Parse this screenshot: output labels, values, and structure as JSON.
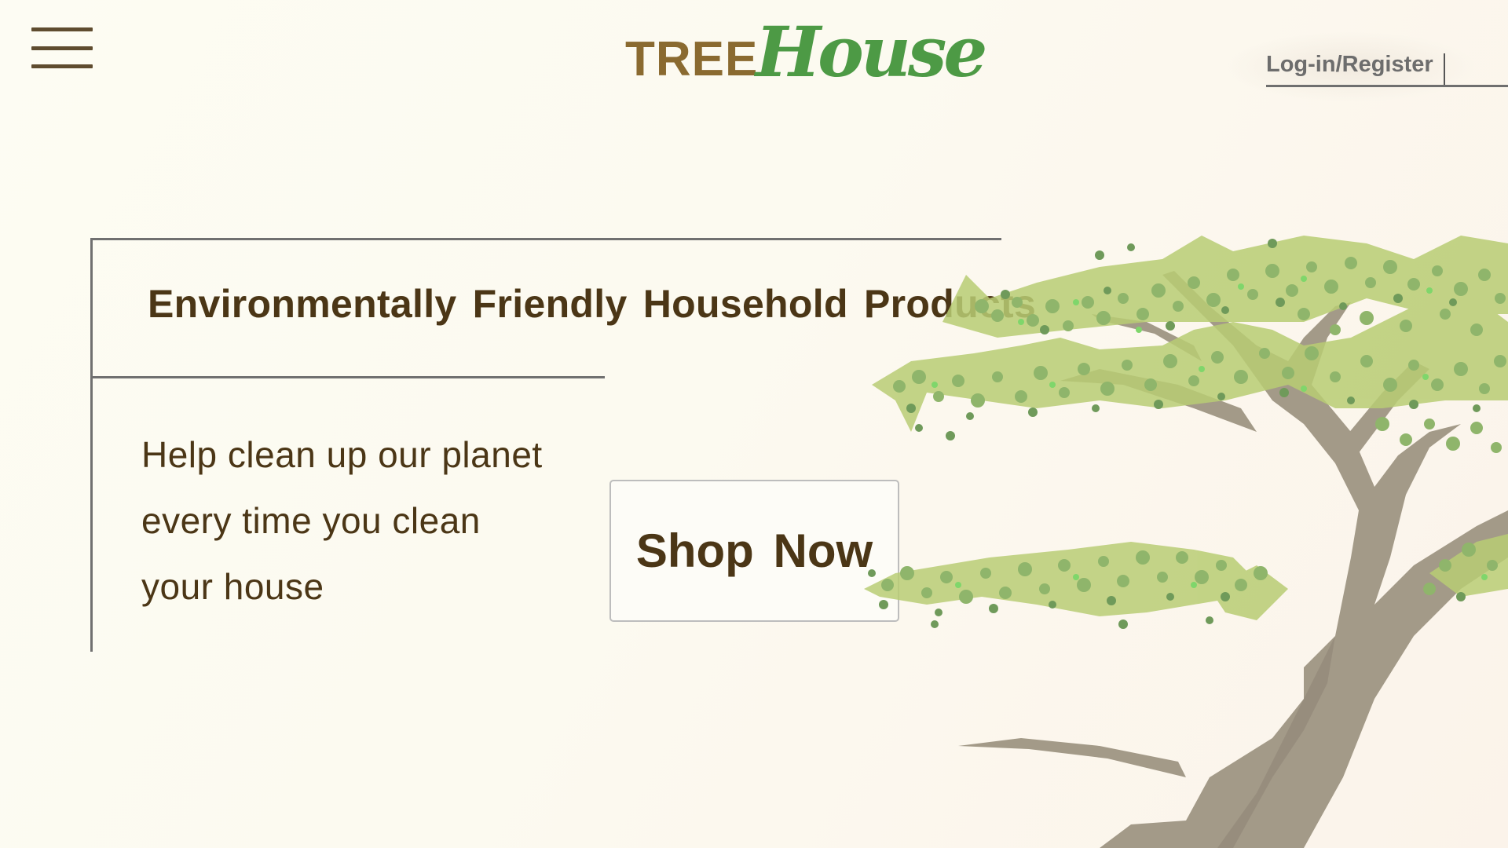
{
  "header": {
    "menu_icon": "hamburger-menu-icon",
    "logo": {
      "part1": "TREE",
      "part2": "House"
    },
    "login_label": "Log-in/Register"
  },
  "hero": {
    "title": "Environmentally Friendly Household Products",
    "tagline_lines": [
      "Help clean up our planet",
      "every time you clean",
      "your house"
    ],
    "cta_label": "Shop Now"
  },
  "illustration": {
    "icon": "bonsai-tree-illustration"
  },
  "colors": {
    "background": "#fcfaf0",
    "text_brown": "#4b3616",
    "logo_brown": "#8a6a30",
    "logo_green": "#4d9a45",
    "frame_gray": "#707070",
    "foliage_green": "#8fb56b",
    "trunk_gray": "#a39a88"
  }
}
